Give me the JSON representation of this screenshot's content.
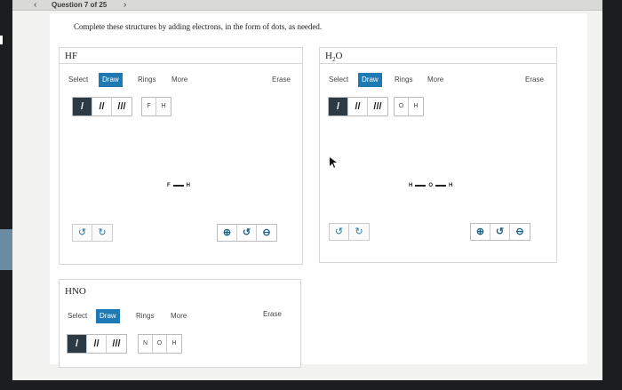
{
  "header": {
    "question_label": "Question 7 of 25",
    "prev_glyph": "‹",
    "next_glyph": "›"
  },
  "prompt": "Complete these structures by adding electrons, in the form of dots, as needed.",
  "panels": [
    {
      "title": "HF",
      "menu": {
        "select": "Select",
        "draw": "Draw",
        "rings": "Rings",
        "more": "More",
        "erase": "Erase"
      },
      "atoms": [
        "F",
        "H"
      ],
      "molecule": [
        "F",
        "H"
      ]
    },
    {
      "title_main": "H",
      "title_sub": "2",
      "title_tail": "O",
      "menu": {
        "select": "Select",
        "draw": "Draw",
        "rings": "Rings",
        "more": "More",
        "erase": "Erase"
      },
      "atoms": [
        "O",
        "H"
      ],
      "molecule": [
        "H",
        "O",
        "H"
      ]
    },
    {
      "title": "HNO",
      "menu": {
        "select": "Select",
        "draw": "Draw",
        "rings": "Rings",
        "more": "More",
        "erase": "Erase"
      },
      "atoms": [
        "N",
        "O",
        "H"
      ]
    }
  ],
  "icons": {
    "single_bond": "/",
    "double_bond": "//",
    "triple_bond": "///",
    "undo": "↺",
    "redo": "↻",
    "zoom_in": "⊕",
    "zoom_reset": "↺",
    "zoom_out": "⊖"
  },
  "colors": {
    "accent": "#1f7ab3",
    "selected_tool": "#2c3a46"
  }
}
